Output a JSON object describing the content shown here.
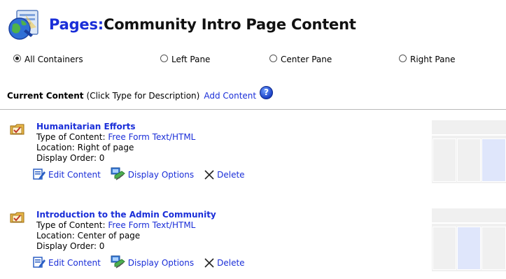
{
  "header": {
    "title_prefix": "Pages:",
    "title_rest": "Community Intro Page Content"
  },
  "containers": {
    "options": [
      {
        "label": "All Containers",
        "checked": true
      },
      {
        "label": "Left Pane",
        "checked": false
      },
      {
        "label": "Center Pane",
        "checked": false
      },
      {
        "label": "Right Pane",
        "checked": false
      }
    ]
  },
  "current_content": {
    "heading": "Current Content",
    "hint": "(Click Type for Description)",
    "add_label": "Add Content",
    "help_symbol": "?"
  },
  "entries": [
    {
      "title": "Humanitarian Efforts",
      "type_label": "Type of Content: ",
      "type_value": "Free Form Text/HTML",
      "location": "Location: Right of page",
      "display_order": "Display Order: 0",
      "highlight_pane": "right"
    },
    {
      "title": "Introduction to the Admin Community",
      "type_label": "Type of Content: ",
      "type_value": "Free Form Text/HTML",
      "location": "Location: Center of page",
      "display_order": "Display Order: 0",
      "highlight_pane": "center"
    }
  ],
  "actions": {
    "edit": "Edit Content",
    "display": "Display Options",
    "delete": "Delete"
  },
  "colors": {
    "link": "#1a2ed8",
    "thumb_bg": "#f0f0f0",
    "thumb_highlight": "#dfe6fb"
  },
  "icons": {
    "header": "pages-globe-icon",
    "folder": "folder-check-icon",
    "edit": "edit-content-icon",
    "display": "display-options-icon",
    "delete": "delete-x-icon",
    "help": "help-icon"
  }
}
